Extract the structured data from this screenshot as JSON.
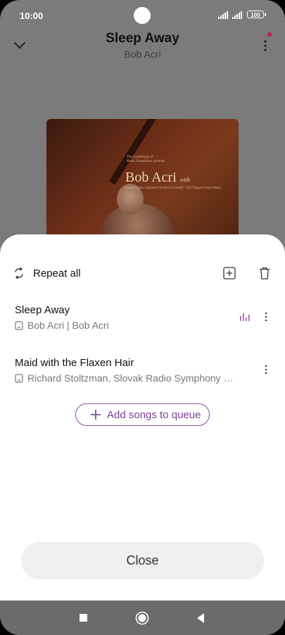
{
  "status_bar": {
    "time": "10:00",
    "battery": "100"
  },
  "header": {
    "title": "Sleep Away",
    "artist": "Bob Acri"
  },
  "album_art": {
    "credit_small": "The Candlelight of\nMusic Foundation presents",
    "name": "Bob Acri",
    "name_suffix": "with",
    "credit_line": "Chase Dallas Lawrence Frank Lee Soloff - Ed Thigpen Frank Mano"
  },
  "queue_sheet": {
    "repeat_label": "Repeat all",
    "items": [
      {
        "title": "Sleep Away",
        "subtitle": "Bob Acri | Bob Acri",
        "playing": true
      },
      {
        "title": "Maid with the Flaxen Hair",
        "subtitle": "Richard Stoltzman, Slovak Radio Symphony Orchestra",
        "playing": false
      }
    ],
    "add_songs_label": "Add songs to queue",
    "close_label": "Close"
  },
  "colors": {
    "accent": "#7b3f8f",
    "dim_overlay": "#7b7b7b",
    "notification_dot": "#c2185b"
  }
}
